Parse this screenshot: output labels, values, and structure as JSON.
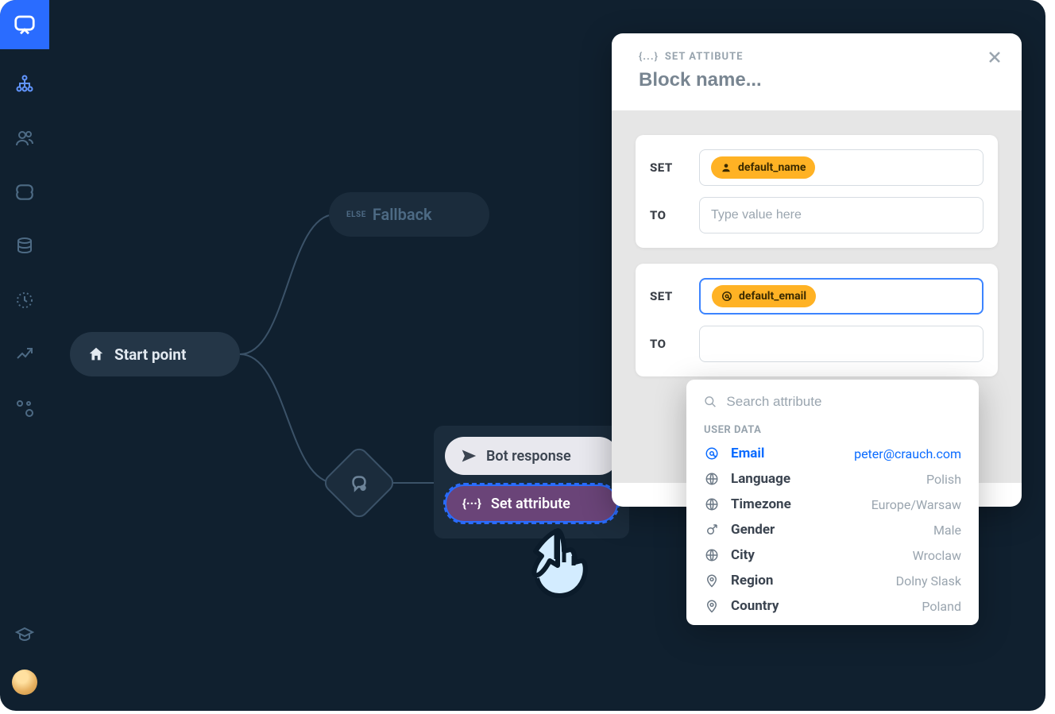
{
  "sidebar": {
    "items": [
      "flow",
      "users",
      "ai",
      "data",
      "history",
      "analytics",
      "integrations",
      "academy"
    ]
  },
  "canvas": {
    "start_label": "Start point",
    "fallback_badge": "ELSE",
    "fallback_label": "Fallback",
    "bot_response_label": "Bot response",
    "set_attribute_label": "Set attribute"
  },
  "panel": {
    "subtitle_icon": "{...}",
    "subtitle": "SET ATTIBUTE",
    "block_name_placeholder": "Block name...",
    "cards": [
      {
        "set_label": "SET",
        "to_label": "TO",
        "chip_icon": "user",
        "chip_text": "default_name",
        "to_placeholder": "Type value here"
      },
      {
        "set_label": "SET",
        "to_label": "TO",
        "chip_icon": "at",
        "chip_text": "default_email",
        "to_placeholder": ""
      }
    ]
  },
  "dropdown": {
    "search_placeholder": "Search attribute",
    "section": "USER DATA",
    "items": [
      {
        "icon": "at",
        "key": "Email",
        "val": "peter@crauch.com",
        "selected": true
      },
      {
        "icon": "globe",
        "key": "Language",
        "val": "Polish"
      },
      {
        "icon": "globe",
        "key": "Timezone",
        "val": "Europe/Warsaw"
      },
      {
        "icon": "gender",
        "key": "Gender",
        "val": "Male"
      },
      {
        "icon": "globe",
        "key": "City",
        "val": "Wroclaw"
      },
      {
        "icon": "pin",
        "key": "Region",
        "val": "Dolny Slask"
      },
      {
        "icon": "pin",
        "key": "Country",
        "val": "Poland"
      }
    ]
  }
}
